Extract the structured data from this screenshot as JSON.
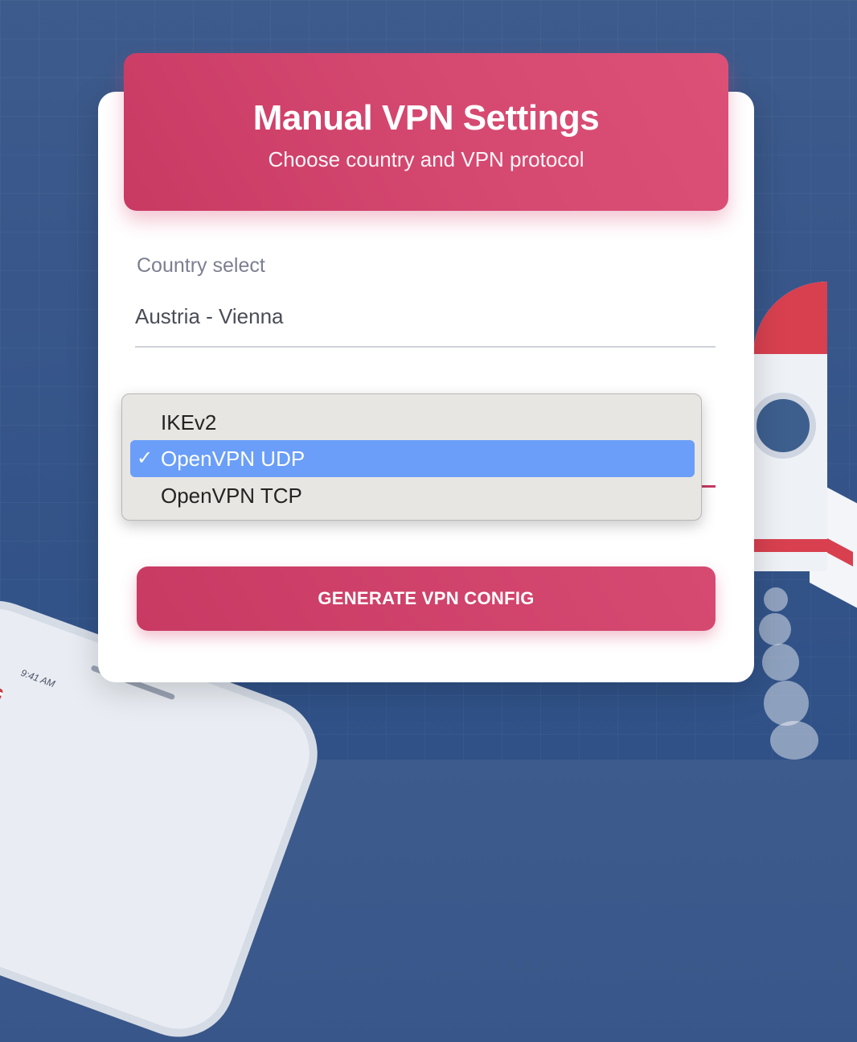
{
  "header": {
    "title": "Manual VPN Settings",
    "subtitle": "Choose country and VPN protocol"
  },
  "country": {
    "label": "Country select",
    "value": "Austria - Vienna"
  },
  "protocol": {
    "options": [
      {
        "label": "IKEv2",
        "selected": false
      },
      {
        "label": "OpenVPN UDP",
        "selected": true
      },
      {
        "label": "OpenVPN TCP",
        "selected": false
      }
    ],
    "check_glyph": "✓"
  },
  "actions": {
    "generate_label": "GENERATE VPN CONFIG"
  },
  "background": {
    "phone_time": "9:41 AM"
  },
  "colors": {
    "accent": "#d64a72",
    "selection": "#6a9ef8",
    "background": "#3a5888"
  }
}
